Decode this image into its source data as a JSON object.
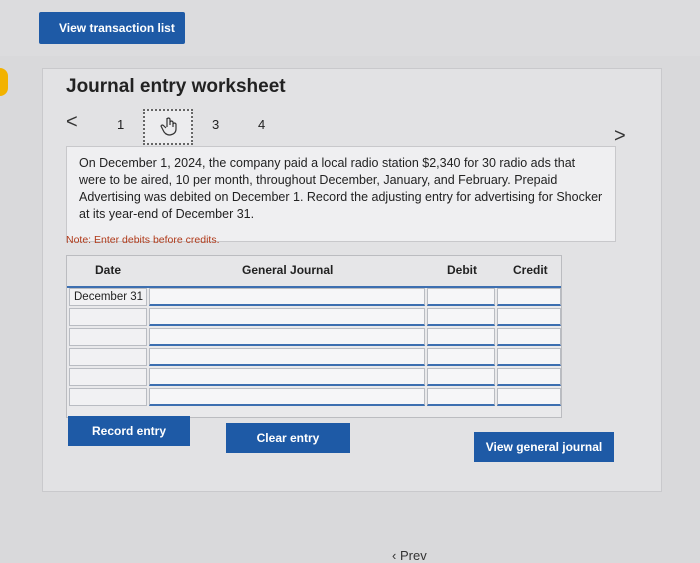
{
  "header": {
    "view_transactions_label": "View transaction list"
  },
  "worksheet": {
    "title": "Journal entry worksheet",
    "steps": [
      "1",
      "3",
      "4"
    ],
    "nav_prev": "<",
    "nav_next": ">",
    "problem_text": "On December 1, 2024, the company paid a local radio station $2,340 for 30 radio ads that were to be aired, 10 per month, throughout December, January, and February. Prepaid Advertising was debited on December 1. Record the adjusting entry for advertising for Shocker at its year-end of December 31.",
    "note": "Note: Enter debits before credits.",
    "table": {
      "headers": {
        "date": "Date",
        "journal": "General Journal",
        "debit": "Debit",
        "credit": "Credit"
      },
      "first_date": "December 31"
    },
    "buttons": {
      "record": "Record entry",
      "clear": "Clear entry",
      "view_general": "View general journal"
    }
  },
  "footer": {
    "prev_label": "Prev"
  },
  "colors": {
    "accent": "#1e5aa6",
    "note": "#b03a1a"
  }
}
